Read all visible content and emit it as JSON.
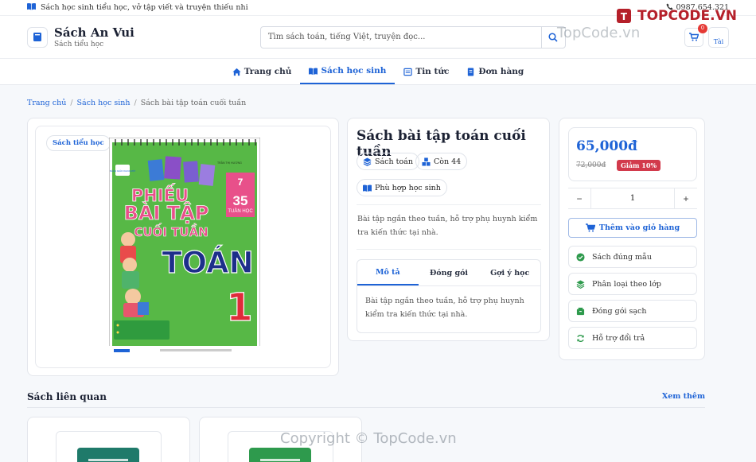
{
  "topbar": {
    "text": "Sách học sinh tiểu học, vở tập viết và truyện thiếu nhi",
    "phone": "0987.654.321"
  },
  "header": {
    "brand_title": "Sách An Vui",
    "brand_subtitle": "Sách tiểu học",
    "search_placeholder": "Tìm sách toán, tiếng Việt, truyện đọc...",
    "cart_count": "0",
    "avatar_alt": "Tài"
  },
  "nav": [
    {
      "label": "Trang chủ",
      "icon": "home-icon"
    },
    {
      "label": "Sách học sinh",
      "icon": "book-open-icon",
      "active": true
    },
    {
      "label": "Tin tức",
      "icon": "newspaper-icon"
    },
    {
      "label": "Đơn hàng",
      "icon": "receipt-icon"
    }
  ],
  "breadcrumb": {
    "home": "Trang chủ",
    "category": "Sách học sinh",
    "current": "Sách bài tập toán cuối tuần"
  },
  "product": {
    "category_tag": "Sách tiểu học",
    "title": "Sách bài tập toán cuối tuần",
    "chips": {
      "subject": "Sách toán",
      "stock": "Còn 44",
      "suitable": "Phù hợp học sinh"
    },
    "description": "Bài tập ngắn theo tuần, hỗ trợ phụ huynh kiểm tra kiến thức tại nhà.",
    "tabs": [
      "Mô tả",
      "Đóng gói",
      "Gợi ý học"
    ],
    "tab_content": "Bài tập ngắn theo tuần, hỗ trợ phụ huynh kiểm tra kiến thức tại nhà.",
    "cover": {
      "publisher_badge": "SÁCH GIÁO KHOA MỚI",
      "author": "TRẦN THỊ HƯƠNG",
      "line1": "PHIẾU",
      "line2": "BÀI TẬP",
      "line3": "CUỐI TUẦN",
      "weeks_num": "35",
      "weeks_label": "TUẦN HỌC",
      "subject": "TOÁN",
      "grade": "1"
    }
  },
  "purchase": {
    "price": "65,000đ",
    "old_price": "72,000đ",
    "discount": "Giảm 10%",
    "qty_minus": "−",
    "qty": "1",
    "qty_plus": "+",
    "add_to_cart": "Thêm vào giỏ hàng",
    "features": [
      {
        "label": "Sách đúng mẫu",
        "icon": "check-circle-icon"
      },
      {
        "label": "Phân loại theo lớp",
        "icon": "layers-icon"
      },
      {
        "label": "Đóng gói sạch",
        "icon": "box-icon"
      },
      {
        "label": "Hỗ trợ đổi trả",
        "icon": "refresh-icon"
      }
    ]
  },
  "related": {
    "title": "Sách liên quan",
    "see_more": "Xem thêm"
  },
  "watermark": {
    "logo": "TOPCODE.VN",
    "mid": "TopCode.vn",
    "bottom": "Copyright © TopCode.vn"
  },
  "colors": {
    "accent": "#1e63d6",
    "discount": "#d23a4c",
    "related_book_1": "#1f7a6a",
    "related_book_2": "#2e9a4d"
  }
}
